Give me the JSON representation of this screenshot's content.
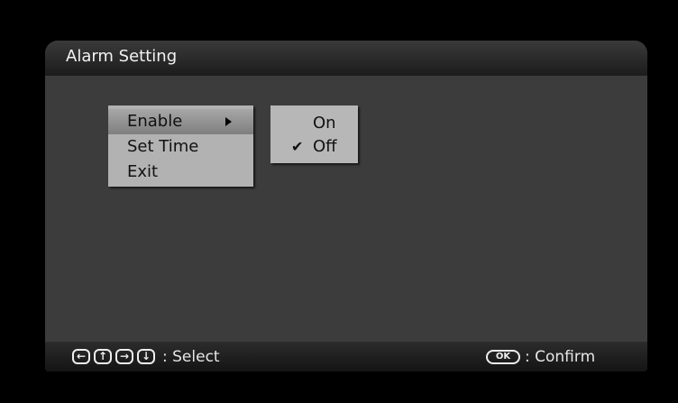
{
  "window": {
    "title": "Alarm Setting"
  },
  "menu": {
    "items": [
      {
        "label": "Enable",
        "selected": true,
        "has_submenu": true
      },
      {
        "label": "Set Time",
        "selected": false,
        "has_submenu": false
      },
      {
        "label": "Exit",
        "selected": false,
        "has_submenu": false
      }
    ]
  },
  "submenu": {
    "options": [
      {
        "label": "On",
        "checked": false
      },
      {
        "label": "Off",
        "checked": true
      }
    ],
    "check_glyph": "✔"
  },
  "footer": {
    "navigation_icons": [
      "left-arrow-key-icon",
      "up-arrow-key-icon",
      "right-arrow-key-icon",
      "down-arrow-key-icon"
    ],
    "navigation_glyphs": [
      "←",
      "↑",
      "→",
      "↓"
    ],
    "select_text": ": Select",
    "ok_key": "OK",
    "confirm_text": ": Confirm"
  },
  "colors": {
    "background": "#3c3c3c",
    "menu": "#b2b2b2",
    "selected_item": "#8f8f8f",
    "text_light": "#f2f2f2",
    "text_dark": "#111111"
  }
}
